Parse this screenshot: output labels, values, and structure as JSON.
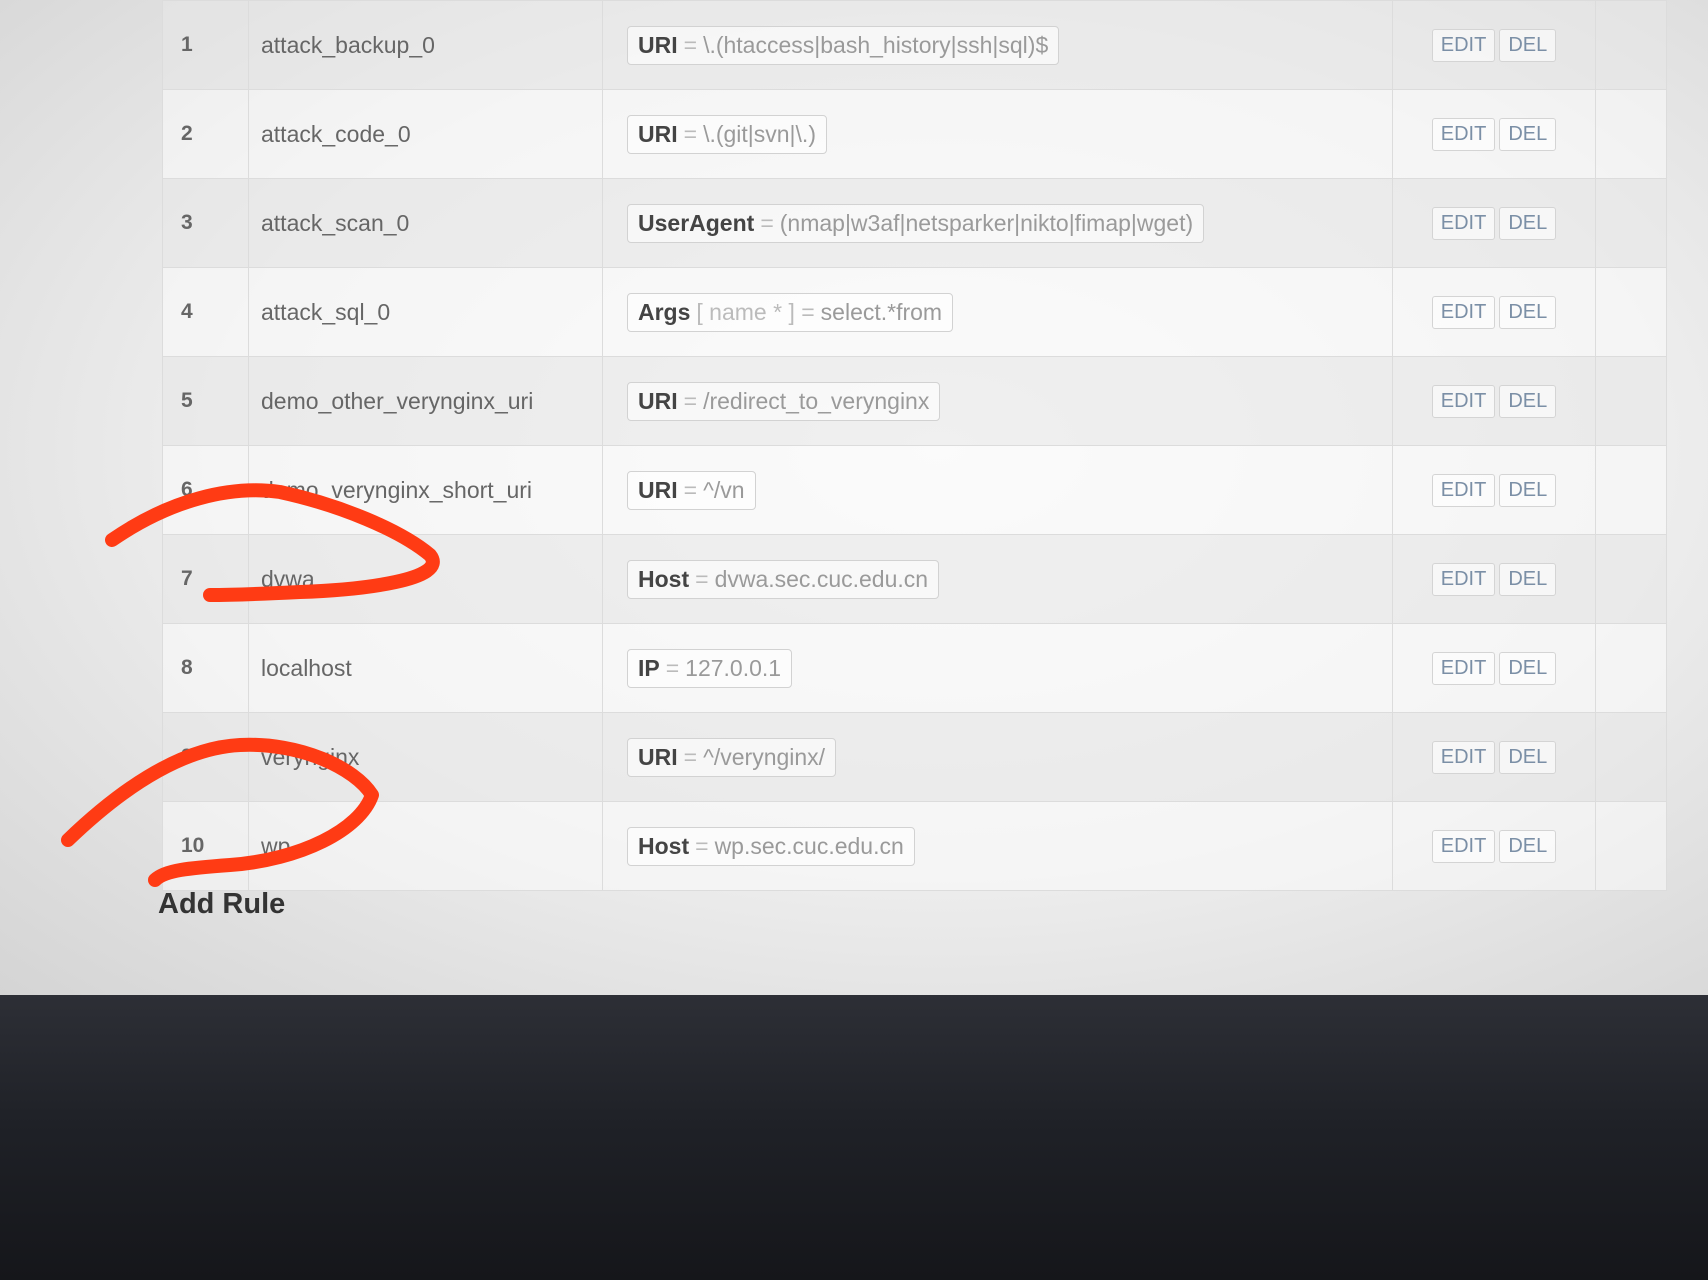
{
  "rules": [
    {
      "index": "1",
      "name": "attack_backup_0",
      "field": "URI",
      "op": "=",
      "value": "\\.(htaccess|bash_history|ssh|sql)$"
    },
    {
      "index": "2",
      "name": "attack_code_0",
      "field": "URI",
      "op": "=",
      "value": "\\.(git|svn|\\.)"
    },
    {
      "index": "3",
      "name": "attack_scan_0",
      "field": "UserAgent",
      "op": "=",
      "value": "(nmap|w3af|netsparker|nikto|fimap|wget)"
    },
    {
      "index": "4",
      "name": "attack_sql_0",
      "field": "Args",
      "op": "[ name * ] =",
      "value": "select.*from"
    },
    {
      "index": "5",
      "name": "demo_other_verynginx_uri",
      "field": "URI",
      "op": "=",
      "value": "/redirect_to_verynginx"
    },
    {
      "index": "6",
      "name": "demo_verynginx_short_uri",
      "field": "URI",
      "op": "=",
      "value": "^/vn"
    },
    {
      "index": "7",
      "name": "dvwa",
      "field": "Host",
      "op": "=",
      "value": "dvwa.sec.cuc.edu.cn"
    },
    {
      "index": "8",
      "name": "localhost",
      "field": "IP",
      "op": "=",
      "value": "127.0.0.1"
    },
    {
      "index": "9",
      "name": "verynginx",
      "field": "URI",
      "op": "=",
      "value": "^/verynginx/"
    },
    {
      "index": "10",
      "name": "wp",
      "field": "Host",
      "op": "=",
      "value": "wp.sec.cuc.edu.cn"
    }
  ],
  "actions": {
    "edit_label": "EDIT",
    "del_label": "DEL"
  },
  "add_rule_label": "Add Rule",
  "annotation_color": "#ff3b14"
}
